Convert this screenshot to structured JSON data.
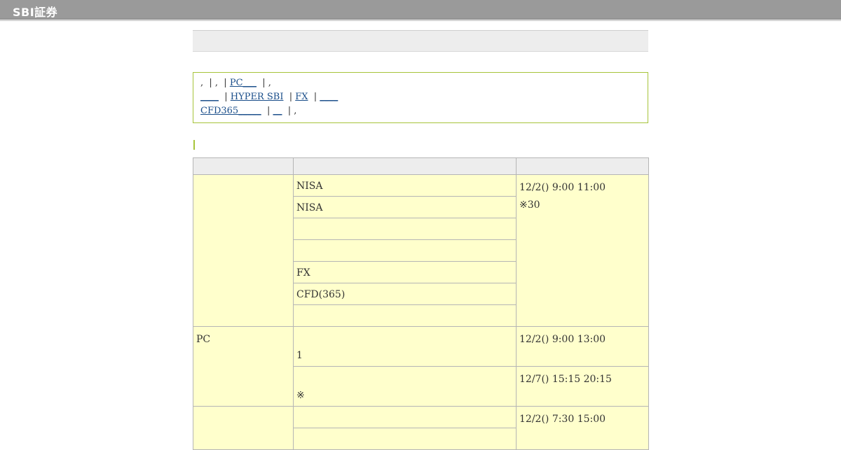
{
  "header": {
    "logo_text": "SBI証券"
  },
  "notice": {
    "line1_prefix": ",  | ,  | ",
    "line1_link": "PC___",
    "line1_suffix": "  | ,",
    "line2_link1": "____",
    "line2_sep1": "  | ",
    "line2_link2": "HYPER SBI",
    "line2_sep2": "  | ",
    "line2_link3": "FX",
    "line2_sep3": "  | ",
    "line2_link4": "____",
    "line3_link1": "CFD365_____",
    "line3_sep1": "  | ",
    "line3_link2": "__",
    "line3_suffix": "  | ,"
  },
  "table": {
    "headers": [
      "",
      "",
      ""
    ],
    "group1": {
      "category": "",
      "services": [
        "NISA",
        "NISA",
        "",
        "",
        "FX",
        "CFD(365)",
        ""
      ],
      "time": "12/2() 9:00 11:00",
      "note": "※30"
    },
    "group2": {
      "category": "PC",
      "row1_service": "1",
      "row1_time": "12/2() 9:00 13:00",
      "row2_service": "※",
      "row2_time": "12/7() 15:15 20:15"
    },
    "group3": {
      "category": "",
      "row1_service": "",
      "row1_time": "12/2() 7:30 15:00",
      "row2_service": ""
    }
  }
}
